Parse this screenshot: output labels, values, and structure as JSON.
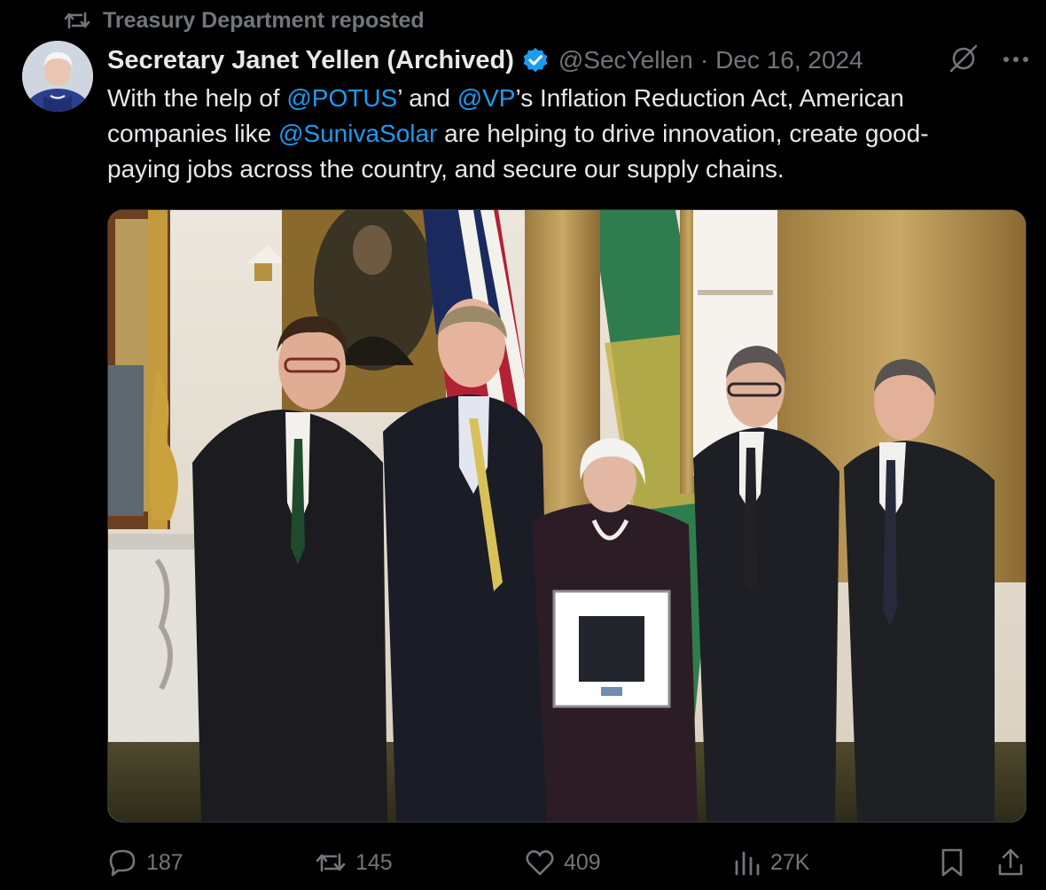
{
  "repost": {
    "label": "Treasury Department reposted",
    "icon": "repost-icon"
  },
  "author": {
    "name": "Secretary Janet Yellen (Archived)",
    "handle": "@SecYellen",
    "separator": "·",
    "date": "Dec 16, 2024",
    "verified": true,
    "badge_color": "#1d9bf0"
  },
  "tweet": {
    "segments": [
      {
        "text": "With the help of ",
        "mention": false
      },
      {
        "text": "@POTUS",
        "mention": true
      },
      {
        "text": "’ and ",
        "mention": false
      },
      {
        "text": "@VP",
        "mention": true
      },
      {
        "text": "’s Inflation Reduction Act, American\ncompanies like ",
        "mention": false
      },
      {
        "text": "@SunivaSolar",
        "mention": true
      },
      {
        "text": " are helping to drive innovation, create good-\npaying jobs across the country, and secure our supply chains.",
        "mention": false
      }
    ]
  },
  "header_icons": {
    "grok": "grok-icon",
    "more": "more-icon"
  },
  "media": {
    "type": "photo",
    "alt": ""
  },
  "actions": {
    "replies": "187",
    "reposts": "145",
    "likes": "409",
    "views": "27K",
    "bookmark_icon": "bookmark-icon",
    "share_icon": "share-icon"
  },
  "colors": {
    "background": "#000000",
    "text": "#e7e9ea",
    "muted": "#71767b",
    "accent": "#1d9bf0"
  }
}
